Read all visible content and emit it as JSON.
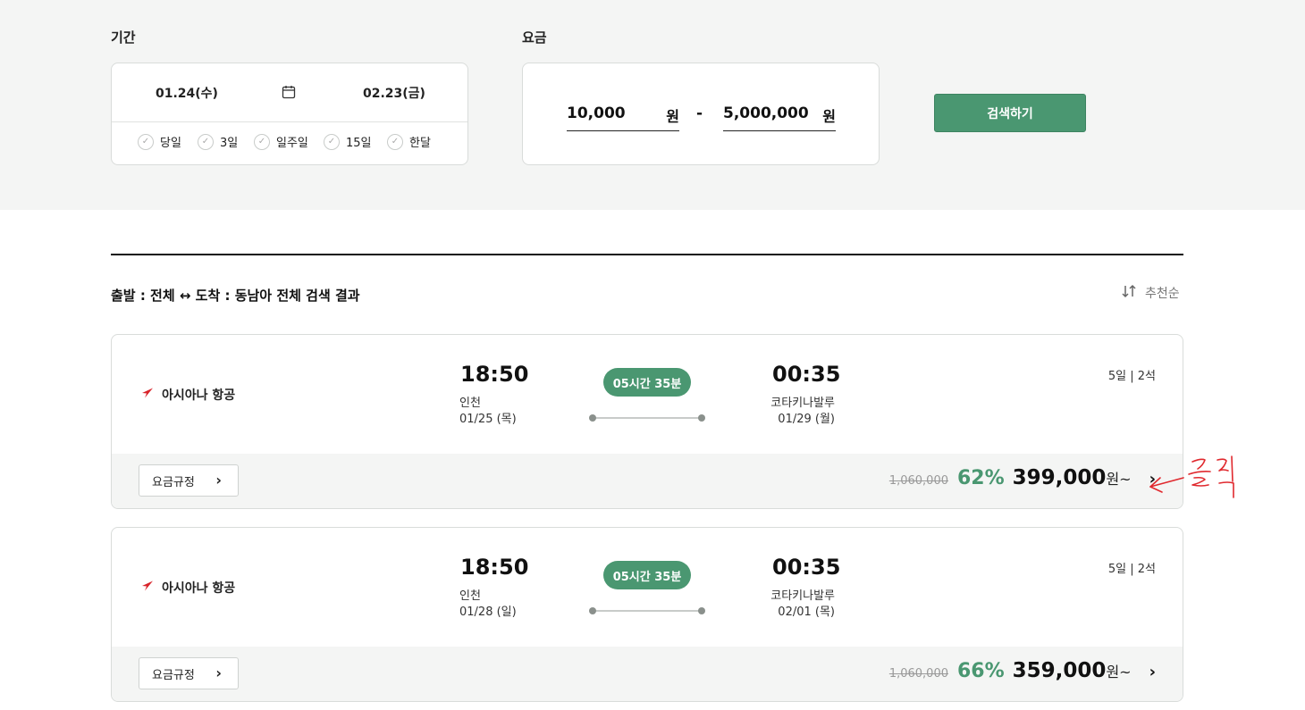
{
  "filters": {
    "period_label": "기간",
    "start_date": "01.24(수)",
    "end_date": "02.23(금)",
    "quick_options": [
      "당일",
      "3일",
      "일주일",
      "15일",
      "한달"
    ],
    "fare_label": "요금",
    "min_price": "10,000",
    "max_price": "5,000,000",
    "unit": "원",
    "separator": "-",
    "search_label": "검색하기"
  },
  "results": {
    "title": "출발 : 전체 ↔ 도착 : 동남아 전체 검색 결과",
    "sort_label": "추천순"
  },
  "cards": [
    {
      "airline": "아시아나 항공",
      "dep_time": "18:50",
      "dep_place": "인천",
      "dep_date": "01/25 (목)",
      "duration": "05시간 35분",
      "arr_time": "00:35",
      "arr_place": "코타키나발루",
      "arr_date": "01/29 (월)",
      "info": "5일 | 2석",
      "rules_label": "요금규정",
      "original_price": "1,060,000",
      "discount": "62%",
      "price": "399,000",
      "won_suffix": "원~"
    },
    {
      "airline": "아시아나 항공",
      "dep_time": "18:50",
      "dep_place": "인천",
      "dep_date": "01/28 (일)",
      "duration": "05시간 35분",
      "arr_time": "00:35",
      "arr_place": "코타키나발루",
      "arr_date": "02/01 (목)",
      "info": "5일 | 2석",
      "rules_label": "요금규정",
      "original_price": "1,060,000",
      "discount": "66%",
      "price": "359,000",
      "won_suffix": "원~"
    }
  ],
  "annotation": {
    "text": "클릭",
    "color": "#e0292e"
  },
  "colors": {
    "accent": "#4a9771",
    "airline_logo": "#d8232a"
  }
}
